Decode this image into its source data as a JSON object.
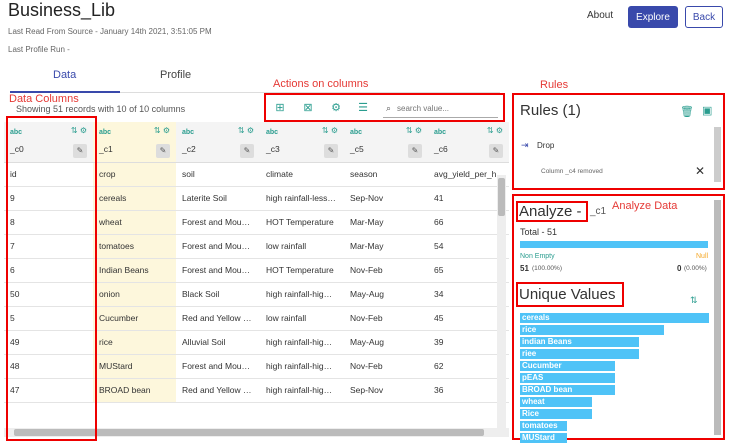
{
  "header": {
    "title": "Business_Lib",
    "last_read": "Last Read From Source - January 14th 2021, 3:51:05 PM",
    "last_profile": "Last Profile Run -",
    "about": "About",
    "explore": "Explore",
    "back": "Back"
  },
  "tabs": {
    "data": "Data",
    "profile": "Profile"
  },
  "annotations": {
    "actions": "Actions on columns",
    "rules": "Rules",
    "data_columns": "Data Columns",
    "analyze": "Analyze Data"
  },
  "records_info": "Showing 51 records with 10 of 10 columns",
  "search": {
    "placeholder": "search value..."
  },
  "table": {
    "type_label": "abc",
    "columns": [
      "_c0",
      "_c1",
      "_c2",
      "_c3",
      "_c5",
      "_c6"
    ],
    "rows": [
      [
        "id",
        "crop",
        "soil",
        "climate",
        "season",
        "avg_yield_per_h"
      ],
      [
        "9",
        "cereals",
        "Laterite Soil",
        "high rainfall-less…",
        "Sep-Nov",
        "41"
      ],
      [
        "8",
        "wheat",
        "Forest and Mou…",
        "HOT Temperature",
        "Mar-May",
        "66"
      ],
      [
        "7",
        "tomatoes",
        "Forest and Mou…",
        "low rainfall",
        "Mar-May",
        "54"
      ],
      [
        "6",
        "Indian Beans",
        "Forest and Mou…",
        "HOT Temperature",
        "Nov-Feb",
        "65"
      ],
      [
        "50",
        "onion",
        "Black Soil",
        "high rainfall-hig…",
        "May-Aug",
        "34"
      ],
      [
        "5",
        "Cucumber",
        "Red and Yellow …",
        "low rainfall",
        "Nov-Feb",
        "45"
      ],
      [
        "49",
        "rice",
        "Alluvial Soil",
        "high rainfall-hig…",
        "May-Aug",
        "39"
      ],
      [
        "48",
        "MUStard",
        "Forest and Mou…",
        "high rainfall-hig…",
        "Nov-Feb",
        "62"
      ],
      [
        "47",
        "BROAD bean",
        "Red and Yellow …",
        "high rainfall-hig…",
        "Sep-Nov",
        "36"
      ]
    ]
  },
  "rules": {
    "title": "Rules (1)",
    "item_label": "Drop",
    "item_desc": "Column _c4 removed"
  },
  "analyze": {
    "title": "Analyze - ",
    "column": "_c1",
    "total": "Total - 51",
    "non_empty_label": "Non Empty",
    "null_label": "Null",
    "non_empty_value": "51",
    "non_empty_pct": "(100.00%)",
    "null_value": "0",
    "null_pct": "(0.00%)",
    "unique_title": "Unique Values",
    "unique_values": [
      {
        "label": "cereals",
        "fraction": 1.0
      },
      {
        "label": "rice",
        "fraction": 0.76
      },
      {
        "label": "indian Beans",
        "fraction": 0.63
      },
      {
        "label": "riee",
        "fraction": 0.63
      },
      {
        "label": "Cucumber",
        "fraction": 0.5
      },
      {
        "label": "pEAS",
        "fraction": 0.5
      },
      {
        "label": "BROAD bean",
        "fraction": 0.5
      },
      {
        "label": "wheat",
        "fraction": 0.38
      },
      {
        "label": "Rice",
        "fraction": 0.38
      },
      {
        "label": "tomatoes",
        "fraction": 0.25
      },
      {
        "label": "MUStard",
        "fraction": 0.25
      }
    ]
  },
  "colors": {
    "primary": "#3949ab",
    "accent": "#2a9d8f",
    "annotation": "#e53935",
    "bar": "#4fc3f7",
    "highlight": "#fdf7dc"
  }
}
